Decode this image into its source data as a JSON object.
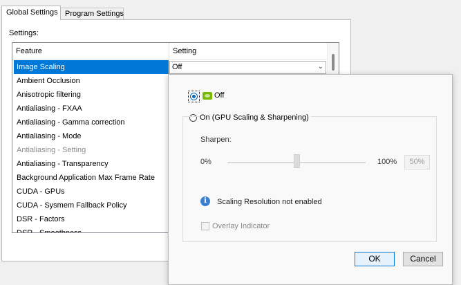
{
  "tabs": [
    {
      "label": "Global Settings",
      "active": true
    },
    {
      "label": "Program Settings",
      "active": false
    }
  ],
  "settings_label": "Settings:",
  "list": {
    "headers": {
      "feature": "Feature",
      "setting": "Setting"
    },
    "selected": {
      "feature": "Image Scaling",
      "setting": "Off"
    },
    "items": [
      {
        "label": "Ambient Occlusion",
        "enabled": true
      },
      {
        "label": "Anisotropic filtering",
        "enabled": true
      },
      {
        "label": "Antialiasing - FXAA",
        "enabled": true
      },
      {
        "label": "Antialiasing - Gamma correction",
        "enabled": true
      },
      {
        "label": "Antialiasing - Mode",
        "enabled": true
      },
      {
        "label": "Antialiasing - Setting",
        "enabled": false
      },
      {
        "label": "Antialiasing - Transparency",
        "enabled": true
      },
      {
        "label": "Background Application Max Frame Rate",
        "enabled": true
      },
      {
        "label": "CUDA - GPUs",
        "enabled": true
      },
      {
        "label": "CUDA - Sysmem Fallback Policy",
        "enabled": true
      },
      {
        "label": "DSR - Factors",
        "enabled": true
      },
      {
        "label": "DSR - Smoothness",
        "enabled": true
      }
    ]
  },
  "popup": {
    "option_off": "Off",
    "option_on": "On (GPU Scaling & Sharpening)",
    "sharpen_label": "Sharpen:",
    "min_label": "0%",
    "max_label": "100%",
    "value_box": "50%",
    "sharpen_value_percent": 50,
    "info_text": "Scaling Resolution not enabled",
    "overlay_label": "Overlay Indicator",
    "ok_label": "OK",
    "cancel_label": "Cancel"
  },
  "colors": {
    "selection": "#0078d7",
    "nvidia_green": "#76b900",
    "disabled_text": "#8c8c8c"
  }
}
